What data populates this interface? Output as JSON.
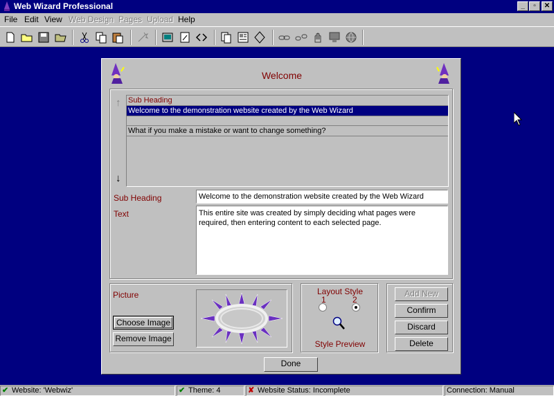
{
  "app": {
    "title": "Web Wizard Professional",
    "caption_buttons": [
      "_",
      "▫",
      "✕"
    ]
  },
  "menu": [
    {
      "label": "File",
      "enabled": true
    },
    {
      "label": "Edit",
      "enabled": true
    },
    {
      "label": "View",
      "enabled": true
    },
    {
      "label": "Web Design",
      "enabled": false
    },
    {
      "label": "Pages",
      "enabled": false
    },
    {
      "label": "Upload",
      "enabled": false
    },
    {
      "label": "Help",
      "enabled": true
    }
  ],
  "toolbar_icons": [
    "new-icon",
    "open-icon",
    "save-icon",
    "open-folder-icon",
    "cut-icon",
    "copy-icon",
    "paste-icon",
    "wizard-icon",
    "preview-icon",
    "edit-icon",
    "code-icon",
    "pages-icon",
    "layout-icon",
    "theme-icon",
    "link-icon",
    "unlink-icon",
    "hand-icon",
    "monitor-icon",
    "globe-icon"
  ],
  "dialog": {
    "title": "Welcome",
    "list": {
      "header": "Sub Heading",
      "rows": [
        {
          "text": "Welcome to the demonstration website created by the Web Wizard",
          "selected": true
        },
        {
          "text": "",
          "selected": false
        },
        {
          "text": "What if you make a mistake or want to change something?",
          "selected": false
        }
      ]
    },
    "subheading_label": "Sub Heading",
    "subheading_value": "Welcome to the demonstration website created by the Web Wizard",
    "text_label": "Text",
    "text_value": "This entire site was created by simply deciding what pages were required, then entering content to each selected page.",
    "picture_label": "Picture",
    "choose_image": "Choose Image",
    "remove_image": "Remove Image",
    "layout_style_label": "Layout Style",
    "layout_options": [
      "1",
      "2"
    ],
    "layout_selected": "2",
    "style_preview": "Style Preview",
    "actions": {
      "add_new": "Add New",
      "confirm": "Confirm",
      "discard": "Discard",
      "delete": "Delete"
    },
    "done": "Done"
  },
  "status": {
    "website": "Website: 'Webwiz'",
    "theme": "Theme: 4",
    "website_status": "Website Status: Incomplete",
    "connection": "Connection: Manual"
  },
  "colors": {
    "desktop": "#000080",
    "face": "#c0c0c0",
    "label": "#800000",
    "selection": "#000080",
    "check": "#008000",
    "cross": "#c00000"
  }
}
